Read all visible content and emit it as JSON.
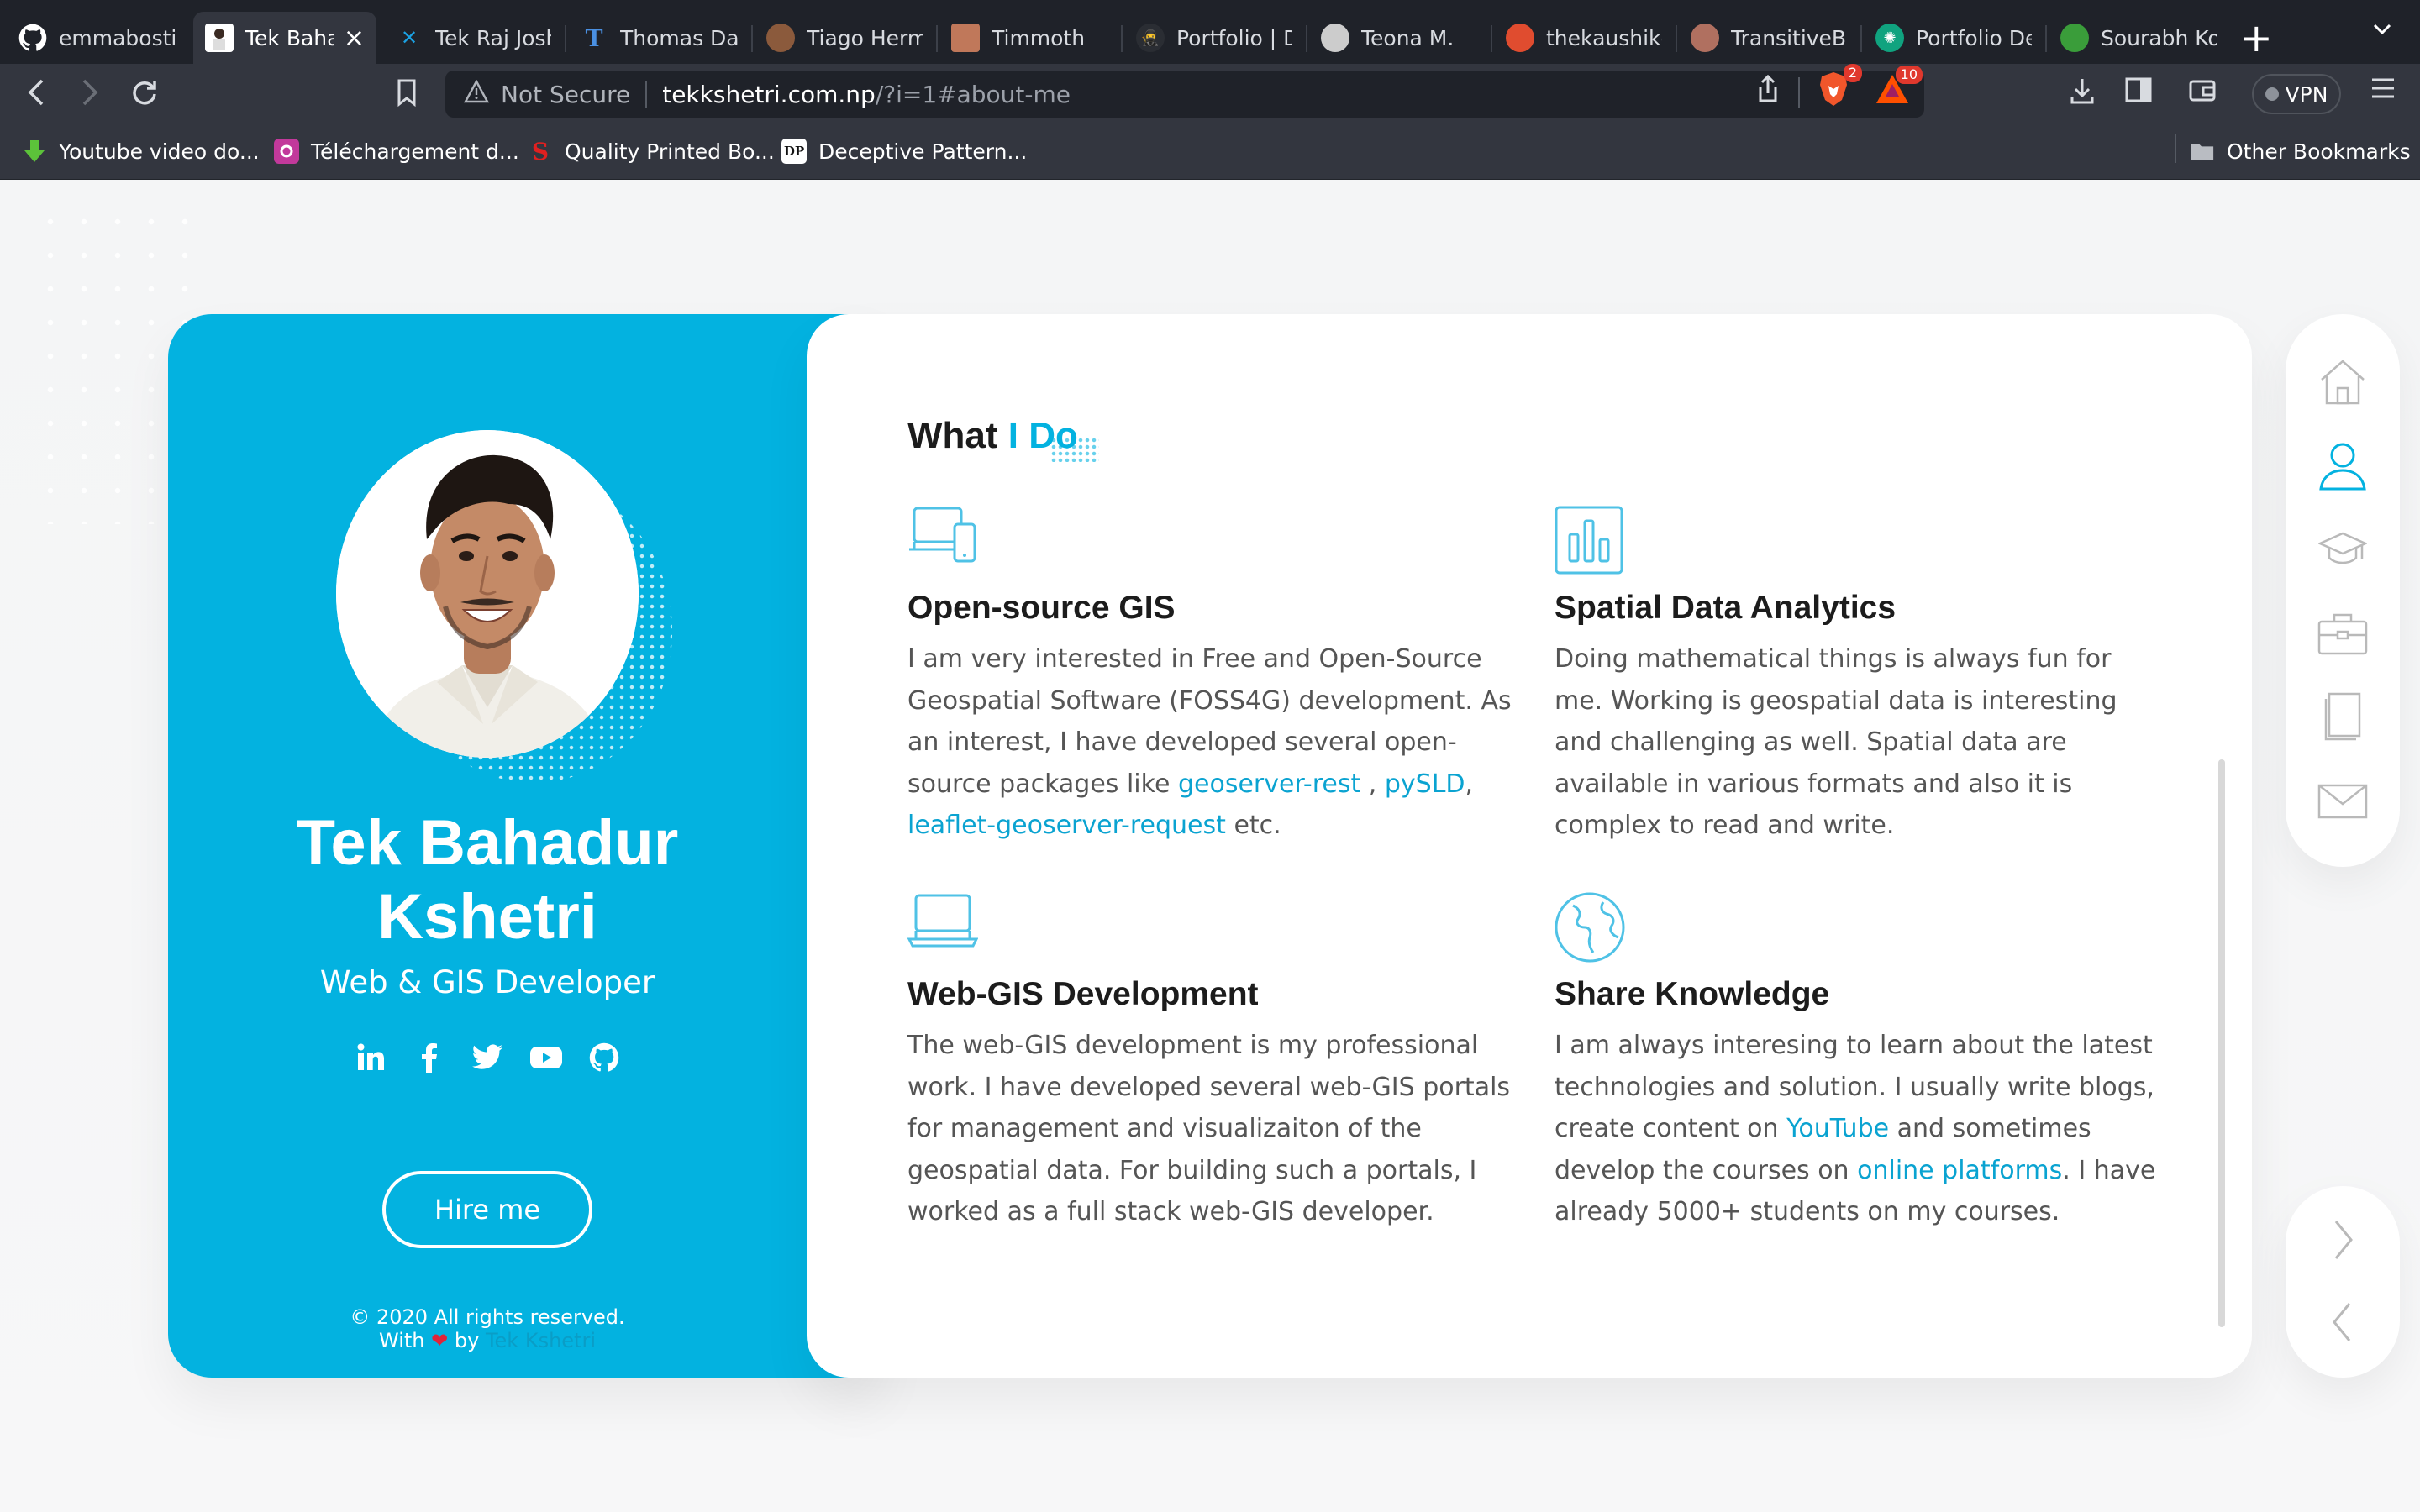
{
  "browser": {
    "tabs": [
      {
        "title": "emmabostian",
        "icon": "github-icon",
        "color": "#ffffff",
        "active": false
      },
      {
        "title": "Tek Baha",
        "icon": "profile-favicon",
        "color": "#ffffff",
        "active": true
      },
      {
        "title": "Tek Raj Joshi",
        "icon": "tr-favicon",
        "color": "#1ba1e2",
        "active": false
      },
      {
        "title": "Thomas Davi",
        "icon": "t-favicon",
        "color": "#4a90e2",
        "active": false
      },
      {
        "title": "Tiago Herma",
        "icon": "avatar-favicon",
        "color": "#8b5a3c",
        "active": false
      },
      {
        "title": "Timmoth",
        "icon": "avatar-favicon",
        "color": "#c0785a",
        "active": false
      },
      {
        "title": "Portfolio | De",
        "icon": "ninja-favicon",
        "color": "#555555",
        "active": false
      },
      {
        "title": "Teona M.",
        "icon": "avatar-favicon",
        "color": "#cccccc",
        "active": false
      },
      {
        "title": "thekaushikgo",
        "icon": "avatar-favicon",
        "color": "#e04c2f",
        "active": false
      },
      {
        "title": "TransitiveBul",
        "icon": "avatar-favicon",
        "color": "#b07060",
        "active": false
      },
      {
        "title": "Portfolio Dev",
        "icon": "openai-favicon",
        "color": "#10a37f",
        "active": false
      },
      {
        "title": "Sourabh Koth",
        "icon": "tree-favicon",
        "color": "#3a9d3a",
        "active": false
      }
    ],
    "tab_close": "×",
    "new_tab": "+",
    "security_label": "Not Secure",
    "url_host": "tekkshetri.com.np",
    "url_path": "/?i=1#about-me",
    "brave_badge": "2",
    "rewards_badge": "10",
    "vpn_label": "VPN",
    "bookmarks": [
      {
        "label": "Youtube video do...",
        "icon": "download-arrow-icon",
        "color": "#5cc23a"
      },
      {
        "label": "Téléchargement d...",
        "icon": "t-favicon",
        "color": "#c2399b"
      },
      {
        "label": "Quality Printed Bo...",
        "icon": "s-favicon",
        "color": "#e02020"
      },
      {
        "label": "Deceptive Pattern...",
        "icon": "dp-favicon",
        "color": "#111111"
      }
    ],
    "other_bookmarks": "Other Bookmarks"
  },
  "profile": {
    "name": "Tek Bahadur Kshetri",
    "role": "Web & GIS Developer",
    "socials": [
      "linkedin-icon",
      "facebook-icon",
      "twitter-icon",
      "youtube-icon",
      "github-icon"
    ],
    "hire_label": "Hire me",
    "copyright": "© 2020 All rights reserved.",
    "made_with": "With",
    "by": "by",
    "author": "Tek Kshetri"
  },
  "content": {
    "title_part1": "What",
    "title_part2": "I Do",
    "features": [
      {
        "icon": "devices-icon",
        "title": "Open-source GIS",
        "text_before": "I am very interested in Free and Open-Source Geospatial Software (FOSS4G) development. As an interest, I have developed several open-source packages like",
        "link1": "geoserver-rest",
        "sep1": " ,",
        "link2": "pySLD",
        "sep2": ",",
        "link3": "leaflet-geoserver-request",
        "text_after": "etc."
      },
      {
        "icon": "bar-chart-icon",
        "title": "Spatial Data Analytics",
        "text": "Doing mathematical things is always fun for me. Working is geospatial data is interesting and challenging as well. Spatial data are available in various formats and also it is complex to read and write."
      },
      {
        "icon": "laptop-icon",
        "title": "Web-GIS Development",
        "text": "The web-GIS development is my professional work. I have developed several web-GIS portals for management and visualizaiton of the geospatial data. For building such a portals, I worked as a full stack web-GIS developer."
      },
      {
        "icon": "globe-icon",
        "title": "Share Knowledge",
        "text_before": "I am always interesing to learn about the latest technologies and solution. I usually write blogs, create content on",
        "link1": "YouTube",
        "text_mid": "and sometimes develop the courses on",
        "link2": "online platforms",
        "text_after": ". I have already 5000+ students on my courses."
      }
    ]
  },
  "sidenav": [
    "home-icon",
    "user-icon",
    "graduation-cap-icon",
    "briefcase-icon",
    "book-icon",
    "mail-icon"
  ],
  "colors": {
    "accent": "#03b2e0",
    "link": "#0aa3d1",
    "nav_active": "#03b2e0",
    "nav_inactive": "#b9b9b9"
  }
}
